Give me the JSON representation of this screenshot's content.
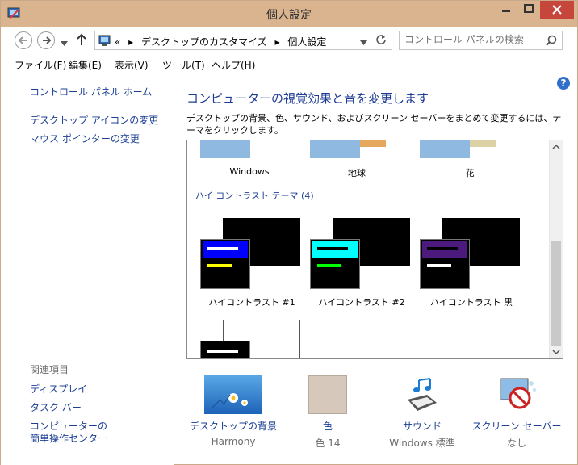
{
  "window": {
    "title": "個人設定"
  },
  "address": {
    "overflow": "«",
    "crumbs": [
      "デスクトップのカスタマイズ",
      "個人設定"
    ],
    "separator": "▸"
  },
  "search": {
    "placeholder": "コントロール パネルの検索"
  },
  "menu": [
    "ファイル(F)",
    "編集(E)",
    "表示(V)",
    "ツール(T)",
    "ヘルプ(H)"
  ],
  "sidebar": {
    "home": "コントロール パネル ホーム",
    "links": [
      "デスクトップ アイコンの変更",
      "マウス ポインターの変更"
    ],
    "related_heading": "関連項目",
    "related": [
      "ディスプレイ",
      "タスク バー",
      "コンピューターの",
      "簡単操作センター"
    ]
  },
  "main": {
    "heading": "コンピューターの視覚効果と音を変更します",
    "description": "デスクトップの背景、色、サウンド、およびスクリーン セーバーをまとめて変更するには、テーマをクリックします。",
    "themes_top": [
      "Windows",
      "地球",
      "花"
    ],
    "hc_group": "ハイ コントラスト テーマ (4)",
    "hc_themes": [
      "ハイコントラスト #1",
      "ハイコントラスト #2",
      "ハイコントラスト 黒"
    ],
    "help": "?"
  },
  "bottom": [
    {
      "label": "デスクトップの背景",
      "sub": "Harmony",
      "icon": "wallpaper-icon"
    },
    {
      "label": "色",
      "sub": "色 14",
      "icon": "color-icon"
    },
    {
      "label": "サウンド",
      "sub": "Windows 標準",
      "icon": "sound-icon"
    },
    {
      "label": "スクリーン セーバー",
      "sub": "なし",
      "icon": "screensaver-icon"
    }
  ],
  "colors": {
    "titlebar": "#d9b48f",
    "close": "#c7463c",
    "link": "#1c3f94",
    "hc1_bar": "#0000ff",
    "hc1_line": "#ffff00",
    "hc2_bar": "#00ffff",
    "hc2_line": "#00ff00",
    "hc3_bar": "#4b1a7c"
  }
}
